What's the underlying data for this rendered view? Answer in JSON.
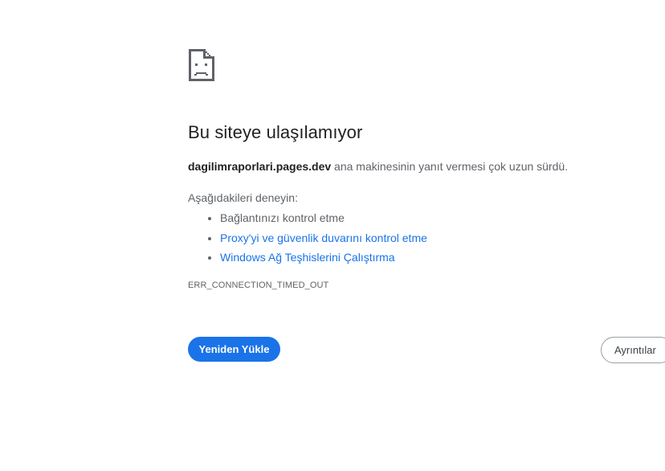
{
  "error_page": {
    "icon": "sad-page-icon",
    "title": "Bu siteye ulaşılamıyor",
    "summary": {
      "host": "dagilimraporlari.pages.dev",
      "message": " ana makinesinin yanıt vermesi çok uzun sürdü."
    },
    "suggestions": {
      "heading": "Aşağıdakileri deneyin:",
      "items": [
        {
          "label": "Bağlantınızı kontrol etme",
          "link": false
        },
        {
          "label": "Proxy'yi ve güvenlik duvarını kontrol etme",
          "link": true
        },
        {
          "label": "Windows Ağ Teşhislerini Çalıştırma",
          "link": true
        }
      ]
    },
    "error_code": "ERR_CONNECTION_TIMED_OUT",
    "buttons": {
      "reload_label": "Yeniden Yükle",
      "details_label": "Ayrıntılar"
    }
  },
  "colors": {
    "accent": "#1a73e8",
    "text_primary": "#202124",
    "text_secondary": "#5f6368"
  }
}
